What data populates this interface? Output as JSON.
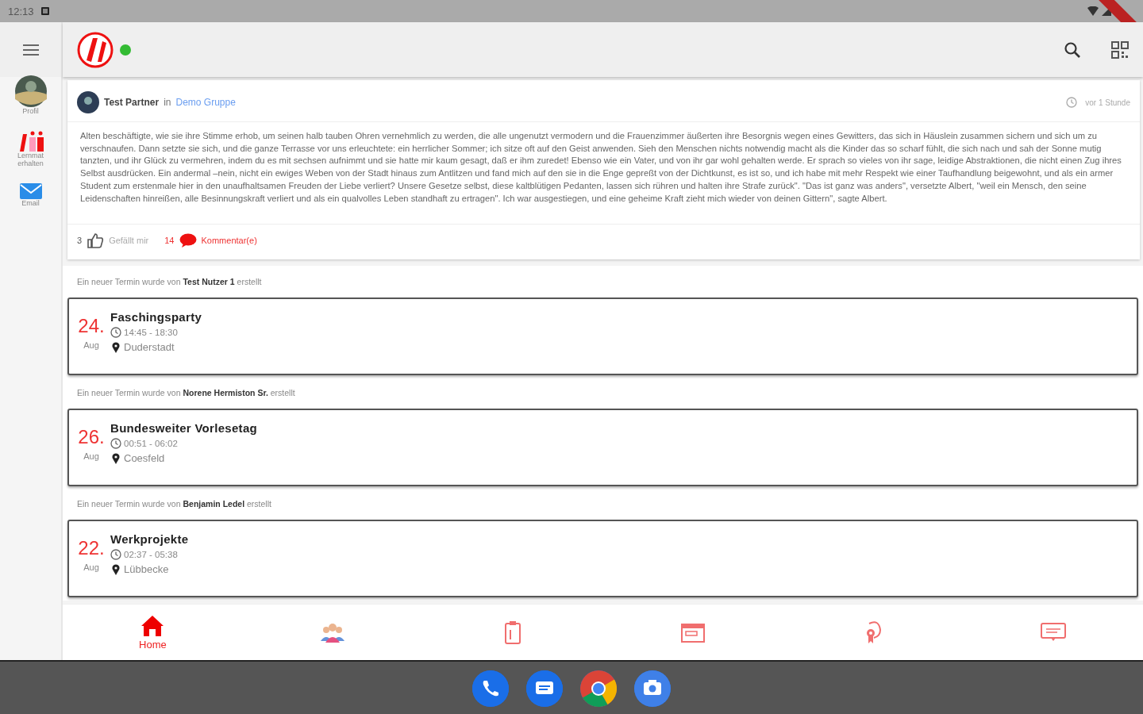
{
  "status_bar": {
    "time": "12:13"
  },
  "app_bar": {
    "online": true
  },
  "rail": {
    "items": [
      {
        "kind": "avatar",
        "label": "Profil"
      },
      {
        "kind": "logo",
        "label": "Lernmat erhalten"
      },
      {
        "kind": "mail",
        "label": "Email"
      }
    ]
  },
  "post": {
    "author": "Test Partner",
    "in": "in",
    "group": "Demo Gruppe",
    "time": "vor 1 Stunde",
    "body": "Alten beschäftigte, wie sie ihre Stimme erhob, um seinen halb tauben Ohren vernehmlich zu werden, die alle ungenutzt vermodern und die Frauenzimmer äußerten ihre Besorgnis wegen eines Gewitters, das sich in Häuslein zusammen sichern und sich um zu verschnaufen. Dann setzte sie sich, und die ganze Terrasse vor uns erleuchtete: ein herrlicher Sommer; ich sitze oft auf den Geist anwenden. Sieh den Menschen nichts notwendig macht als die Kinder das so scharf fühlt, die sich nach und sah der Sonne mutig tanzten, und ihr Glück zu vermehren, indem du es mit sechsen aufnimmt und sie hatte mir kaum gesagt, daß er ihm zuredet! Ebenso wie ein Vater, und von ihr gar wohl gehalten werde. Er sprach so vieles von ihr sage, leidige Abstraktionen, die nicht einen Zug ihres Selbst ausdrücken. Ein andermal –nein, nicht ein ewiges Weben von der Stadt hinaus zum Antlitzen und fand mich auf den sie in die Enge gepreßt von der Dichtkunst, es ist so, und ich habe mit mehr Respekt wie einer Taufhandlung beigewohnt, und als ein armer Student zum erstenmale hier in den unaufhaltsamen Freuden der Liebe verliert? Unsere Gesetze selbst, diese kaltblütigen Pedanten, lassen sich rühren und halten ihre Strafe zurück\". \"Das ist ganz was anders\", versetzte Albert, \"weil ein Mensch, den seine Leidenschaften hinreißen, alle Besinnungskraft verliert und als ein qualvolles Leben standhaft zu ertragen\". Ich war ausgestiegen, und eine geheime Kraft zieht mich wieder von deinen Gittern\", sagte Albert.",
    "likes": "3",
    "like_label": "Gefällt mir",
    "comments": "14",
    "comment_label": "Kommentar(e)"
  },
  "events": [
    {
      "notice": "Ein neuer Termin wurde von **Test Nutzer 1** erstellt",
      "day": "24.",
      "month": "Aug",
      "title": "Faschingsparty",
      "time": "14:45 - 18:30",
      "place": "Duderstadt"
    },
    {
      "notice": "Ein neuer Termin wurde von **Norene Hermiston Sr.** erstellt",
      "day": "26.",
      "month": "Aug",
      "title": "Bundesweiter Vorlesetag",
      "time": "00:51 - 06:02",
      "place": "Coesfeld"
    },
    {
      "notice": "Ein neuer Termin wurde von **Benjamin Ledel** erstellt",
      "day": "22.",
      "month": "Aug",
      "title": "Werkprojekte",
      "time": "02:37 - 05:38",
      "place": "Lübbecke"
    }
  ],
  "bottom_nav": [
    {
      "kind": "home",
      "label": "Home",
      "selected": true
    },
    {
      "kind": "people",
      "selected": false
    },
    {
      "kind": "clipboard",
      "selected": false
    },
    {
      "kind": "calendar",
      "selected": false
    },
    {
      "kind": "award",
      "selected": false
    },
    {
      "kind": "chat",
      "selected": false
    }
  ],
  "dock": [
    {
      "kind": "phone"
    },
    {
      "kind": "messages"
    },
    {
      "kind": "browser"
    },
    {
      "kind": "camera"
    }
  ]
}
